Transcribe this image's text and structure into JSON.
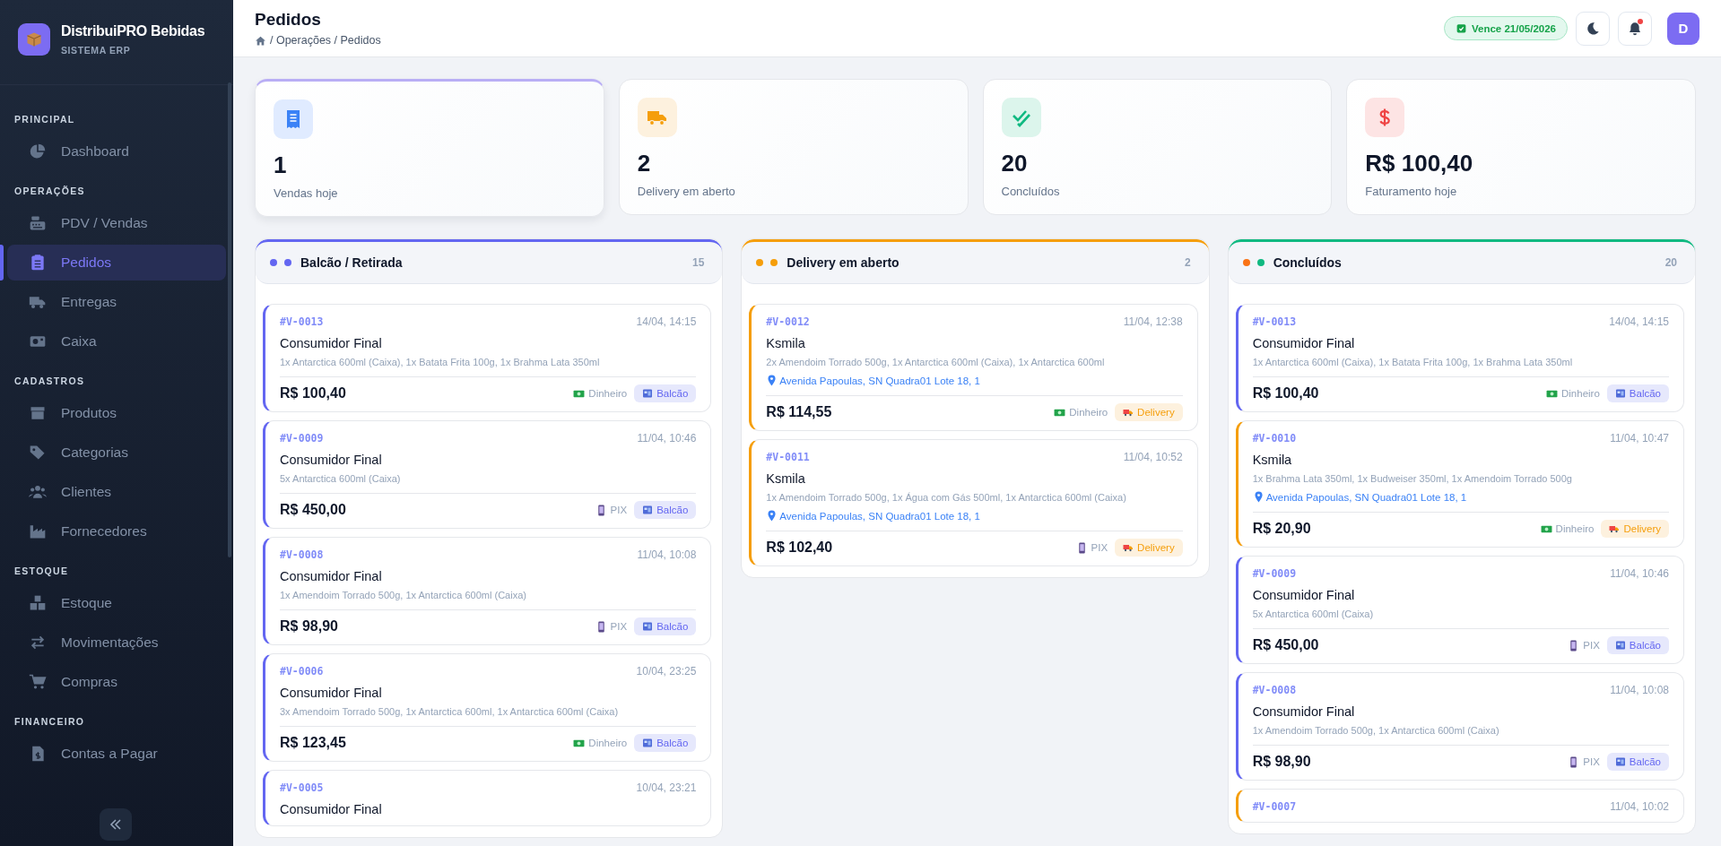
{
  "sidebar": {
    "brand": {
      "name": "DistribuiPRO Bebidas",
      "subtitle": "SISTEMA ERP"
    },
    "sections": [
      {
        "title": "PRINCIPAL",
        "items": [
          {
            "label": "Dashboard",
            "selected": false
          }
        ]
      },
      {
        "title": "OPERAÇÕES",
        "items": [
          {
            "label": "PDV / Vendas",
            "selected": false
          },
          {
            "label": "Pedidos",
            "selected": true
          },
          {
            "label": "Entregas",
            "selected": false
          },
          {
            "label": "Caixa",
            "selected": false
          }
        ]
      },
      {
        "title": "CADASTROS",
        "items": [
          {
            "label": "Produtos",
            "selected": false
          },
          {
            "label": "Categorias",
            "selected": false
          },
          {
            "label": "Clientes",
            "selected": false
          },
          {
            "label": "Fornecedores",
            "selected": false
          }
        ]
      },
      {
        "title": "ESTOQUE",
        "items": [
          {
            "label": "Estoque",
            "selected": false
          },
          {
            "label": "Movimentações",
            "selected": false
          },
          {
            "label": "Compras",
            "selected": false
          }
        ]
      },
      {
        "title": "FINANCEIRO",
        "items": [
          {
            "label": "Contas a Pagar",
            "selected": false
          }
        ]
      }
    ]
  },
  "header": {
    "title": "Pedidos",
    "breadcrumb": "/ Operações / Pedidos",
    "license_badge": "Vence 21/05/2026",
    "notifications_unread": true,
    "avatar_letter": "D"
  },
  "stats": [
    {
      "kind": "receipt",
      "value": "1",
      "label": "Vendas hoje",
      "active": true
    },
    {
      "kind": "truck",
      "value": "2",
      "label": "Delivery em aberto",
      "active": false
    },
    {
      "kind": "check",
      "value": "20",
      "label": "Concluídos",
      "active": false
    },
    {
      "kind": "money",
      "value": "R$ 100,40",
      "label": "Faturamento hoje",
      "active": false
    }
  ],
  "columns": [
    {
      "title": "Balcão / Retirada",
      "count": "15",
      "dots": [
        {
          "color": "#6366f1"
        },
        {
          "color": "#6366f1"
        }
      ],
      "orders": [
        {
          "id": "#V-0013",
          "time": "14/04, 14:15",
          "customer": "Consumidor Final",
          "items": "1x Antarctica 600ml (Caixa), 1x Batata Frita 100g, 1x Brahma Lata 350ml",
          "total": "R$ 100,40",
          "payment": {
            "kind": "cash",
            "label": "Dinheiro"
          },
          "kind": "balcao",
          "tag": "Balcão"
        },
        {
          "id": "#V-0009",
          "time": "11/04, 10:46",
          "customer": "Consumidor Final",
          "items": "5x Antarctica 600ml (Caixa)",
          "total": "R$ 450,00",
          "payment": {
            "kind": "pix",
            "label": "PIX"
          },
          "kind": "balcao",
          "tag": "Balcão"
        },
        {
          "id": "#V-0008",
          "time": "11/04, 10:08",
          "customer": "Consumidor Final",
          "items": "1x Amendoim Torrado 500g, 1x Antarctica 600ml (Caixa)",
          "total": "R$ 98,90",
          "payment": {
            "kind": "pix",
            "label": "PIX"
          },
          "kind": "balcao",
          "tag": "Balcão"
        },
        {
          "id": "#V-0006",
          "time": "10/04, 23:25",
          "customer": "Consumidor Final",
          "items": "3x Amendoim Torrado 500g, 1x Antarctica 600ml, 1x Antarctica 600ml (Caixa)",
          "total": "R$ 123,45",
          "payment": {
            "kind": "cash",
            "label": "Dinheiro"
          },
          "kind": "balcao",
          "tag": "Balcão"
        },
        {
          "id": "#V-0005",
          "time": "10/04, 23:21",
          "customer": "Consumidor Final",
          "kind": "balcao"
        }
      ]
    },
    {
      "title": "Delivery em aberto",
      "count": "2",
      "dots": [
        {
          "color": "#f59e0b"
        },
        {
          "color": "#f59e0b"
        }
      ],
      "orders": [
        {
          "id": "#V-0012",
          "time": "11/04, 12:38",
          "customer": "Ksmila",
          "items": "2x Amendoim Torrado 500g, 1x Antarctica 600ml (Caixa), 1x Antarctica 600ml",
          "address": "Avenida Papoulas, SN Quadra01 Lote 18, 1",
          "total": "R$ 114,55",
          "payment": {
            "kind": "cash",
            "label": "Dinheiro"
          },
          "kind": "delivery",
          "tag": "Delivery"
        },
        {
          "id": "#V-0011",
          "time": "11/04, 10:52",
          "customer": "Ksmila",
          "items": "1x Amendoim Torrado 500g, 1x Água com Gás 500ml, 1x Antarctica 600ml (Caixa)",
          "address": "Avenida Papoulas, SN Quadra01 Lote 18, 1",
          "total": "R$ 102,40",
          "payment": {
            "kind": "pix",
            "label": "PIX"
          },
          "kind": "delivery",
          "tag": "Delivery"
        }
      ]
    },
    {
      "title": "Concluídos",
      "count": "20",
      "dots": [
        {
          "color": "#f97316"
        },
        {
          "color": "#10b981"
        }
      ],
      "orders": [
        {
          "id": "#V-0013",
          "time": "14/04, 14:15",
          "customer": "Consumidor Final",
          "items": "1x Antarctica 600ml (Caixa), 1x Batata Frita 100g, 1x Brahma Lata 350ml",
          "total": "R$ 100,40",
          "payment": {
            "kind": "cash",
            "label": "Dinheiro"
          },
          "kind": "balcao",
          "tag": "Balcão"
        },
        {
          "id": "#V-0010",
          "time": "11/04, 10:47",
          "customer": "Ksmila",
          "items": "1x Brahma Lata 350ml, 1x Budweiser 350ml, 1x Amendoim Torrado 500g",
          "address": "Avenida Papoulas, SN Quadra01 Lote 18, 1",
          "total": "R$ 20,90",
          "payment": {
            "kind": "cash",
            "label": "Dinheiro"
          },
          "kind": "delivery",
          "tag": "Delivery"
        },
        {
          "id": "#V-0009",
          "time": "11/04, 10:46",
          "customer": "Consumidor Final",
          "items": "5x Antarctica 600ml (Caixa)",
          "total": "R$ 450,00",
          "payment": {
            "kind": "pix",
            "label": "PIX"
          },
          "kind": "balcao",
          "tag": "Balcão"
        },
        {
          "id": "#V-0008",
          "time": "11/04, 10:08",
          "customer": "Consumidor Final",
          "items": "1x Amendoim Torrado 500g, 1x Antarctica 600ml (Caixa)",
          "total": "R$ 98,90",
          "payment": {
            "kind": "pix",
            "label": "PIX"
          },
          "kind": "balcao",
          "tag": "Balcão"
        },
        {
          "id": "#V-0007",
          "time": "11/04, 10:02",
          "kind": "delivery"
        }
      ]
    }
  ]
}
